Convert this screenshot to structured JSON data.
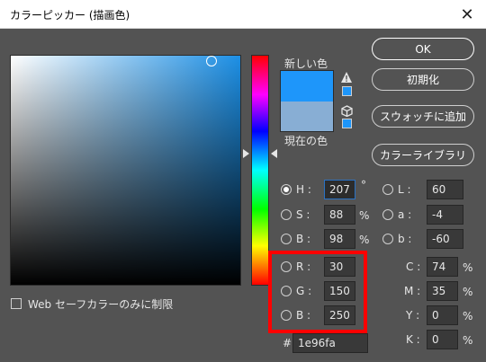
{
  "window": {
    "title": "カラーピッカー (描画色)"
  },
  "preview": {
    "new_label": "新しい色",
    "current_label": "現在の色",
    "new_color": "#1e96fa",
    "current_color": "#88aed4"
  },
  "buttons": {
    "ok": "OK",
    "reset": "初期化",
    "add_swatch": "スウォッチに追加",
    "libraries": "カラーライブラリ"
  },
  "fields": {
    "H": {
      "label": "H :",
      "value": "207",
      "unit": "°",
      "selected": true
    },
    "S": {
      "label": "S :",
      "value": "88",
      "unit": "%"
    },
    "B": {
      "label": "B :",
      "value": "98",
      "unit": "%"
    },
    "R": {
      "label": "R :",
      "value": "30"
    },
    "G": {
      "label": "G :",
      "value": "150"
    },
    "Bl": {
      "label": "B :",
      "value": "250"
    },
    "L": {
      "label": "L :",
      "value": "60"
    },
    "a": {
      "label": "a :",
      "value": "-4"
    },
    "b": {
      "label": "b :",
      "value": "-60"
    },
    "C": {
      "label": "C :",
      "value": "74",
      "unit": "%"
    },
    "M": {
      "label": "M :",
      "value": "35",
      "unit": "%"
    },
    "Y": {
      "label": "Y :",
      "value": "0",
      "unit": "%"
    },
    "K": {
      "label": "K :",
      "value": "0",
      "unit": "%"
    }
  },
  "hex": {
    "label": "#",
    "value": "1e96fa"
  },
  "web_only": {
    "label": "Web セーフカラーのみに制限",
    "checked": false
  },
  "icons": {
    "close": "close-icon",
    "gamut_warning": "warning-triangle-icon",
    "web_cube": "cube-icon"
  },
  "colors": {
    "highlight": "#ff0000"
  }
}
